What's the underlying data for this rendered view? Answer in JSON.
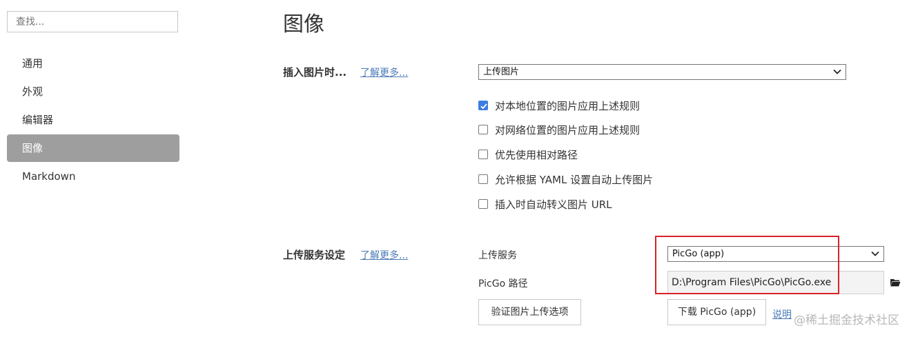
{
  "sidebar": {
    "search_placeholder": "查找...",
    "items": [
      {
        "label": "通用",
        "active": false
      },
      {
        "label": "外观",
        "active": false
      },
      {
        "label": "编辑器",
        "active": false
      },
      {
        "label": "图像",
        "active": true
      },
      {
        "label": "Markdown",
        "active": false
      }
    ]
  },
  "main": {
    "title": "图像",
    "insert_section": {
      "label": "插入图片时...",
      "learn_more": "了解更多...",
      "action_value": "上传图片",
      "checkboxes": [
        {
          "label": "对本地位置的图片应用上述规则",
          "checked": true
        },
        {
          "label": "对网络位置的图片应用上述规则",
          "checked": false
        },
        {
          "label": "优先使用相对路径",
          "checked": false
        },
        {
          "label": "允许根据 YAML 设置自动上传图片",
          "checked": false
        },
        {
          "label": "插入时自动转义图片 URL",
          "checked": false
        }
      ]
    },
    "upload_section": {
      "label": "上传服务设定",
      "learn_more": "了解更多...",
      "service_label": "上传服务",
      "service_value": "PicGo (app)",
      "path_label": "PicGo 路径",
      "path_value": "D:\\Program Files\\PicGo\\PicGo.exe",
      "verify_button": "验证图片上传选项",
      "download_button": "下载 PicGo (app)",
      "help_link": "说明"
    }
  },
  "watermark": "@稀土掘金技术社区",
  "colors": {
    "accent": "#3b7de3",
    "active_nav": "#9e9e9e",
    "highlight_box": "#d8212a",
    "link": "#4a7ab5"
  }
}
